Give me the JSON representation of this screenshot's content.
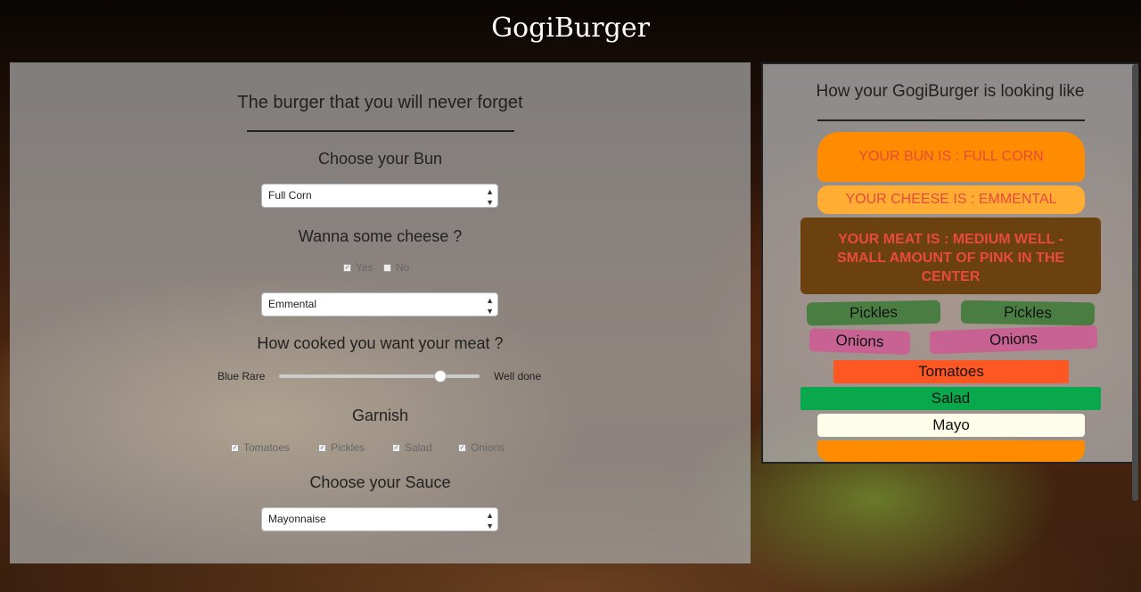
{
  "brand": "GogiBurger",
  "form": {
    "title": "The burger that you will never forget",
    "bun": {
      "heading": "Choose your Bun",
      "selected": "Full Corn"
    },
    "cheese": {
      "heading": "Wanna some cheese ?",
      "yes_label": "Yes",
      "no_label": "No",
      "yes_checked": true,
      "no_checked": false,
      "selected": "Emmental"
    },
    "meat": {
      "heading": "How cooked you want your meat ?",
      "min_label": "Blue Rare",
      "max_label": "Well done",
      "level": 0.8
    },
    "garnish": {
      "heading": "Garnish",
      "options": [
        {
          "label": "Tomatoes",
          "checked": true
        },
        {
          "label": "Pickles",
          "checked": true
        },
        {
          "label": "Salad",
          "checked": true
        },
        {
          "label": "Onions",
          "checked": true
        }
      ]
    },
    "sauce": {
      "heading": "Choose your Sauce",
      "selected": "Mayonnaise"
    }
  },
  "preview": {
    "title": "How your GogiBurger is looking like",
    "bun_top": "Your bun is : Full Corn",
    "cheese": "Your cheese is : Emmental",
    "meat": "Your meat is : Medium Well - small amount of pink in the center",
    "pickles": [
      "Pickles",
      "Pickles"
    ],
    "onions": [
      "Onions",
      "Onions"
    ],
    "tomatoes": "Tomatoes",
    "salad": "Salad",
    "sauce": "Mayo",
    "colors": {
      "bun": "#ff8c00",
      "cheese": "#ffad33",
      "meat": "#6b4110",
      "pickles": "#4a7d42",
      "onions": "#c86292",
      "tomatoes": "#ff5722",
      "salad": "#0aa84c",
      "mayo": "#fdfde9",
      "warning_text": "#e84a3c"
    }
  }
}
